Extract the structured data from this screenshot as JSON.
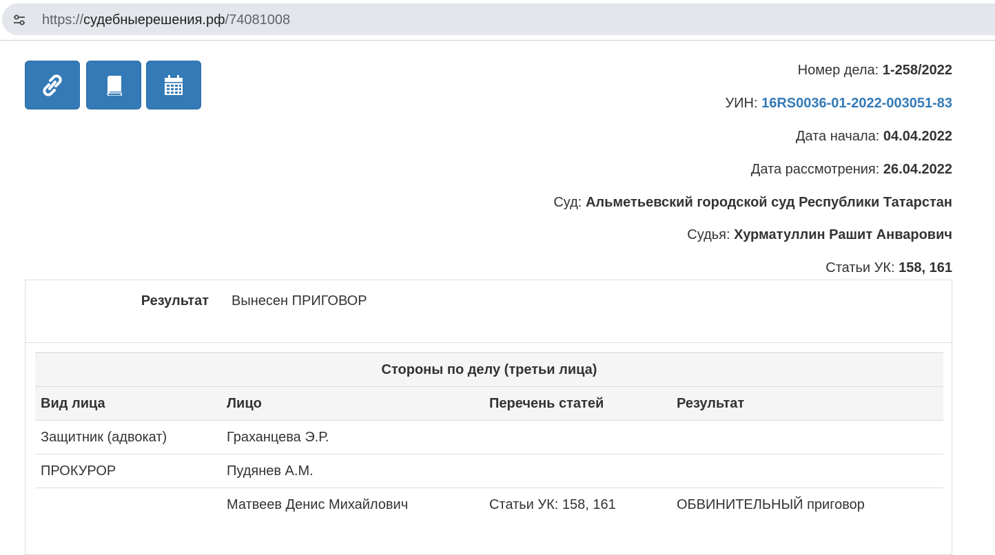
{
  "browser": {
    "url_protocol": "https://",
    "url_domain": "судебныерешения.рф",
    "url_path": "/74081008",
    "site_icon": "tune-icon"
  },
  "toolbar": {
    "buttons": [
      {
        "icon": "link-icon"
      },
      {
        "icon": "book-icon"
      },
      {
        "icon": "calendar-icon"
      }
    ],
    "accent_color": "#337ab7"
  },
  "case_info": {
    "case_number_label": "Номер дела:",
    "case_number": "1-258/2022",
    "uin_label": "УИН:",
    "uin": "16RS0036-01-2022-003051-83",
    "start_date_label": "Дата начала:",
    "start_date": "04.04.2022",
    "review_date_label": "Дата рассмотрения:",
    "review_date": "26.04.2022",
    "court_label": "Суд:",
    "court": "Альметьевский городской суд Республики Татарстан",
    "judge_label": "Судья:",
    "judge": "Хурматуллин Рашит Анварович",
    "articles_label": "Статьи УК:",
    "articles": "158, 161"
  },
  "result": {
    "label": "Результат",
    "value": "Вынесен ПРИГОВОР"
  },
  "parties": {
    "caption": "Стороны по делу (третьи лица)",
    "columns": [
      "Вид лица",
      "Лицо",
      "Перечень статей",
      "Результат"
    ],
    "rows": [
      [
        "Защитник (адвокат)",
        "Граханцева Э.Р.",
        "",
        ""
      ],
      [
        "ПРОКУРОР",
        "Пудянев А.М.",
        "",
        ""
      ],
      [
        "",
        "Матвеев Денис Михайлович",
        "Статьи УК: 158, 161",
        "ОБВИНИТЕЛЬНЫЙ приговор"
      ]
    ]
  }
}
